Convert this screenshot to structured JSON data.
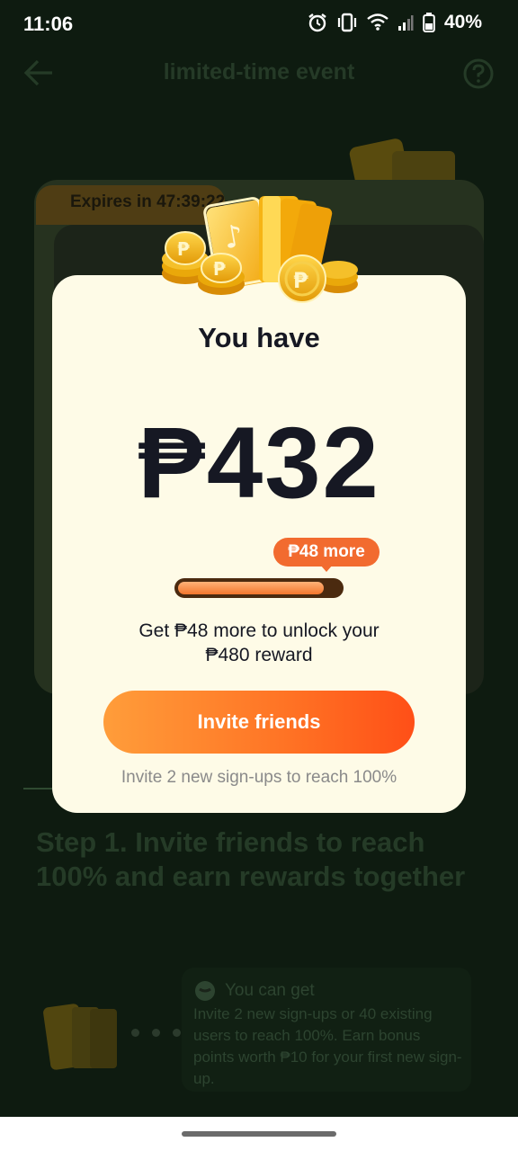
{
  "status_bar": {
    "time": "11:06",
    "battery": "40%"
  },
  "header": {
    "title": "limited-time event",
    "back_icon": "arrow-left-icon",
    "help_icon": "question-circle-icon"
  },
  "background_card": {
    "expires": "Expires in 47:39:22"
  },
  "step": {
    "title": "Step 1. Invite friends to reach 100% and earn rewards together",
    "card_heading": "You can get",
    "card_body": "Invite 2 new sign-ups or 40 existing users to reach 100%. Earn bonus points worth ₱10 for your first new sign-up."
  },
  "modal": {
    "title": "You have",
    "amount": "₱432",
    "tooltip": "₱48 more",
    "progress": 0.9,
    "description_line1": "Get ₱48 more to unlock your",
    "description_line2": "₱480 reward",
    "button_label": "Invite friends",
    "hint": "Invite 2 new sign-ups to reach 100%"
  },
  "colors": {
    "accent": "#ff7224",
    "modal_bg": "#fefbe7",
    "text": "#161823"
  }
}
